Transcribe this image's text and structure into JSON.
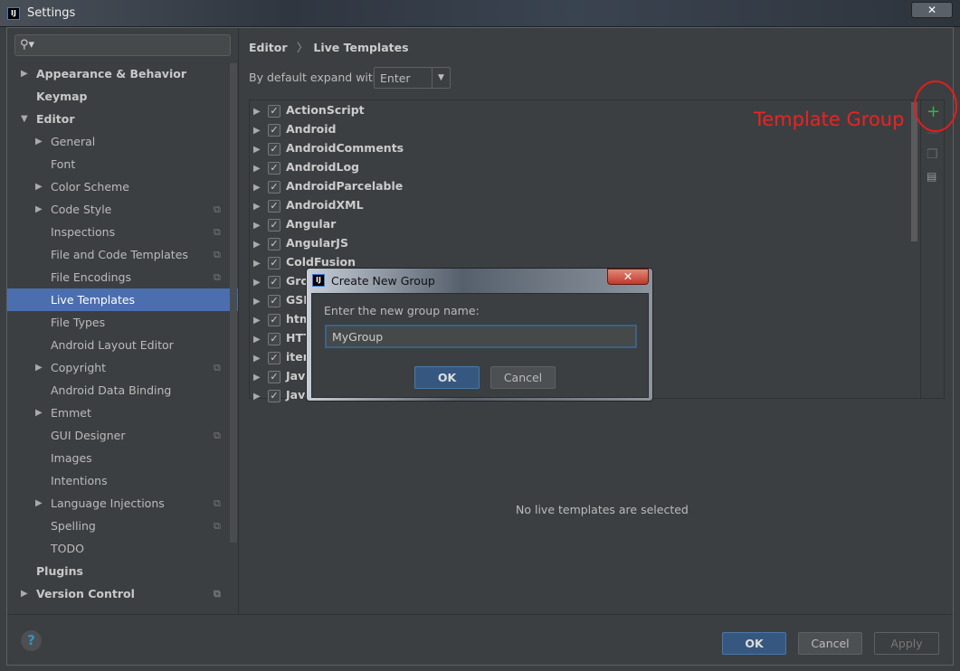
{
  "window": {
    "title": "Settings",
    "close": "✕"
  },
  "sidebar": {
    "items": [
      {
        "label": "Appearance & Behavior",
        "level": 0,
        "arrow": "▶",
        "bold": true
      },
      {
        "label": "Keymap",
        "level": 0,
        "bold": true
      },
      {
        "label": "Editor",
        "level": 0,
        "arrow": "▼",
        "bold": true
      },
      {
        "label": "General",
        "level": 1,
        "arrow": "▶"
      },
      {
        "label": "Font",
        "level": 1
      },
      {
        "label": "Color Scheme",
        "level": 1,
        "arrow": "▶"
      },
      {
        "label": "Code Style",
        "level": 1,
        "arrow": "▶",
        "copy": true
      },
      {
        "label": "Inspections",
        "level": 1,
        "copy": true
      },
      {
        "label": "File and Code Templates",
        "level": 1,
        "copy": true
      },
      {
        "label": "File Encodings",
        "level": 1,
        "copy": true
      },
      {
        "label": "Live Templates",
        "level": 1,
        "selected": true
      },
      {
        "label": "File Types",
        "level": 1
      },
      {
        "label": "Android Layout Editor",
        "level": 1
      },
      {
        "label": "Copyright",
        "level": 1,
        "arrow": "▶",
        "copy": true
      },
      {
        "label": "Android Data Binding",
        "level": 1
      },
      {
        "label": "Emmet",
        "level": 1,
        "arrow": "▶"
      },
      {
        "label": "GUI Designer",
        "level": 1,
        "copy": true
      },
      {
        "label": "Images",
        "level": 1
      },
      {
        "label": "Intentions",
        "level": 1
      },
      {
        "label": "Language Injections",
        "level": 1,
        "arrow": "▶",
        "copy": true
      },
      {
        "label": "Spelling",
        "level": 1,
        "copy": true
      },
      {
        "label": "TODO",
        "level": 1
      },
      {
        "label": "Plugins",
        "level": 0,
        "bold": true
      },
      {
        "label": "Version Control",
        "level": 0,
        "arrow": "▶",
        "bold": true,
        "copy": true
      }
    ]
  },
  "main": {
    "breadcrumb_1": "Editor",
    "breadcrumb_sep": "〉",
    "breadcrumb_2": "Live Templates",
    "expand_label": "By default expand with",
    "expand_value": "Enter",
    "groups": [
      "ActionScript",
      "Android",
      "AndroidComments",
      "AndroidLog",
      "AndroidParcelable",
      "AndroidXML",
      "Angular",
      "AngularJS",
      "ColdFusion",
      "Groovy",
      "GSP",
      "html",
      "HTTP",
      "iterations",
      "Java",
      "JavaScript"
    ],
    "empty_text": "No live templates are selected"
  },
  "annotation": {
    "text": "Template Group",
    "color": "#ee2222"
  },
  "dialog": {
    "title": "Create New Group",
    "prompt": "Enter the new group name:",
    "value": "MyGroup",
    "ok": "OK",
    "cancel": "Cancel",
    "close": "✕"
  },
  "footer": {
    "help": "?",
    "ok": "OK",
    "cancel": "Cancel",
    "apply": "Apply"
  }
}
